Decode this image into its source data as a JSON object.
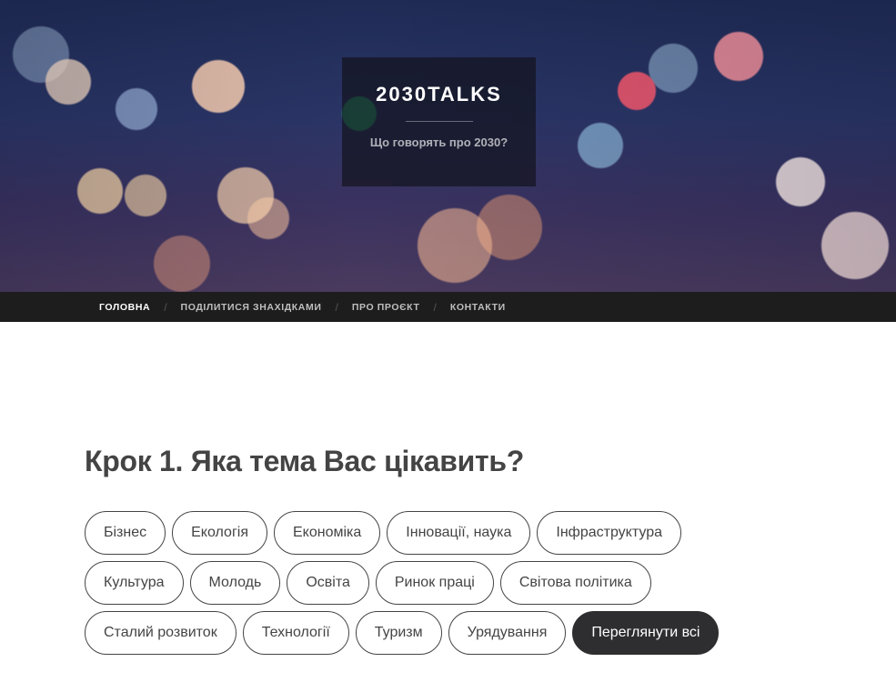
{
  "site": {
    "title": "2030TALKS",
    "tagline": "Що говорять про 2030?"
  },
  "nav": {
    "items": [
      {
        "label": "Головна",
        "active": true
      },
      {
        "label": "Поділитися знахідками"
      },
      {
        "label": "Про проєкт"
      },
      {
        "label": "Контакти"
      }
    ],
    "separator": "/"
  },
  "main": {
    "step_title": "Крок 1. Яка тема Вас цікавить?",
    "tags": [
      "Бізнес",
      "Екологія",
      "Економіка",
      "Інновації, наука",
      "Інфраструктура",
      "Культура",
      "Молодь",
      "Освіта",
      "Ринок праці",
      "Світова політика",
      "Сталий розвиток",
      "Технології",
      "Туризм",
      "Урядування"
    ],
    "view_all_label": "Переглянути всі"
  }
}
